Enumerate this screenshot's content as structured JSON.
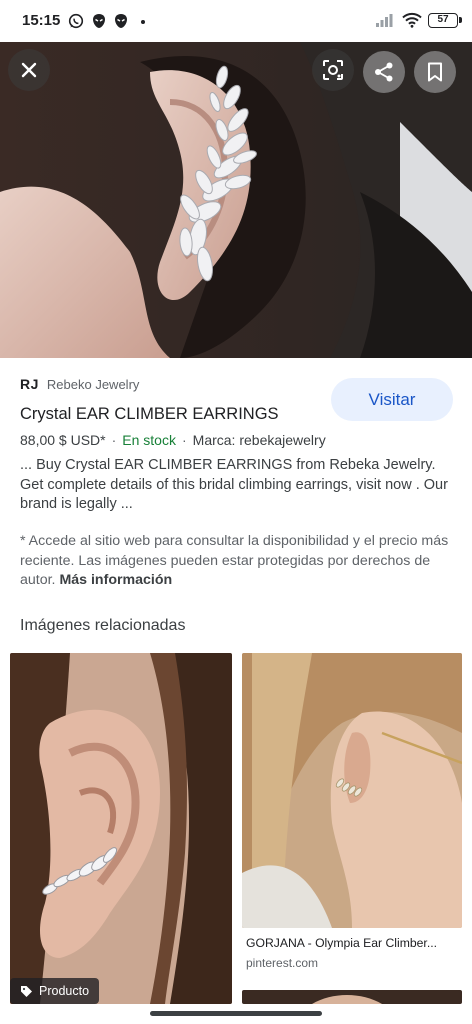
{
  "status_bar": {
    "time": "15:15",
    "notification_icons": [
      "whatsapp-icon",
      "grindr-icon",
      "grindr-icon",
      "dot-icon"
    ],
    "battery": "57"
  },
  "hero": {
    "buttons": [
      "close-icon",
      "lens-icon",
      "share-icon",
      "bookmark-icon"
    ]
  },
  "result": {
    "source_logo": "RJ",
    "source_name": "Rebeko Jewelry",
    "visit_label": "Visitar",
    "title": "Crystal EAR CLIMBER EARRINGS",
    "price": "88,00 $ USD*",
    "stock": "En stock",
    "brand": "Marca: rebekajewelry",
    "snippet": "... Buy Crystal EAR CLIMBER EARRINGS from Rebeka Jewelry. Get complete details of this bridal climbing earrings, visit now . Our brand is legally ...",
    "disclaimer": "* Accede al sitio web para consultar la disponibilidad y el precio más reciente. Las imágenes pueden estar protegidas por derechos de autor.",
    "more_info": "Más información"
  },
  "related": {
    "heading": "Imágenes relacionadas",
    "items": [
      {
        "badge": "Producto",
        "badge_icon": "tag-icon"
      },
      {
        "title": "GORJANA - Olympia Ear Climber...",
        "source": "pinterest.com"
      }
    ]
  },
  "colors": {
    "accent_blue": "#1a56c7",
    "visit_bg": "#e8f0fe",
    "stock_green": "#188038"
  }
}
